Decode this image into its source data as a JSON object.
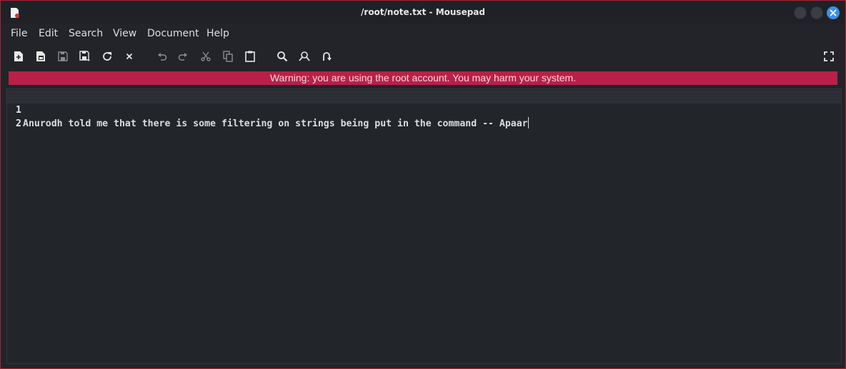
{
  "window": {
    "title": "/root/note.txt - Mousepad"
  },
  "menu": {
    "items": [
      "File",
      "Edit",
      "Search",
      "View",
      "Document",
      "Help"
    ]
  },
  "toolbar": {
    "icons": [
      "new-document-icon",
      "new-window-icon",
      "save-icon",
      "save-as-icon",
      "reload-icon",
      "close-document-icon",
      "undo-icon",
      "redo-icon",
      "cut-icon",
      "copy-icon",
      "paste-icon",
      "find-icon",
      "find-replace-icon",
      "goto-line-icon",
      "fullscreen-icon"
    ]
  },
  "warning": {
    "text": "Warning: you are using the root account. You may harm your system."
  },
  "editor": {
    "lines": [
      {
        "number": "1",
        "text": "Anurodh told me that there is some filtering on strings being put in the command -- Apaar"
      },
      {
        "number": "2",
        "text": ""
      }
    ]
  },
  "colors": {
    "warning_bg": "#b92048",
    "close_button": "#3e8fe6",
    "window_border": "#b0222c"
  }
}
